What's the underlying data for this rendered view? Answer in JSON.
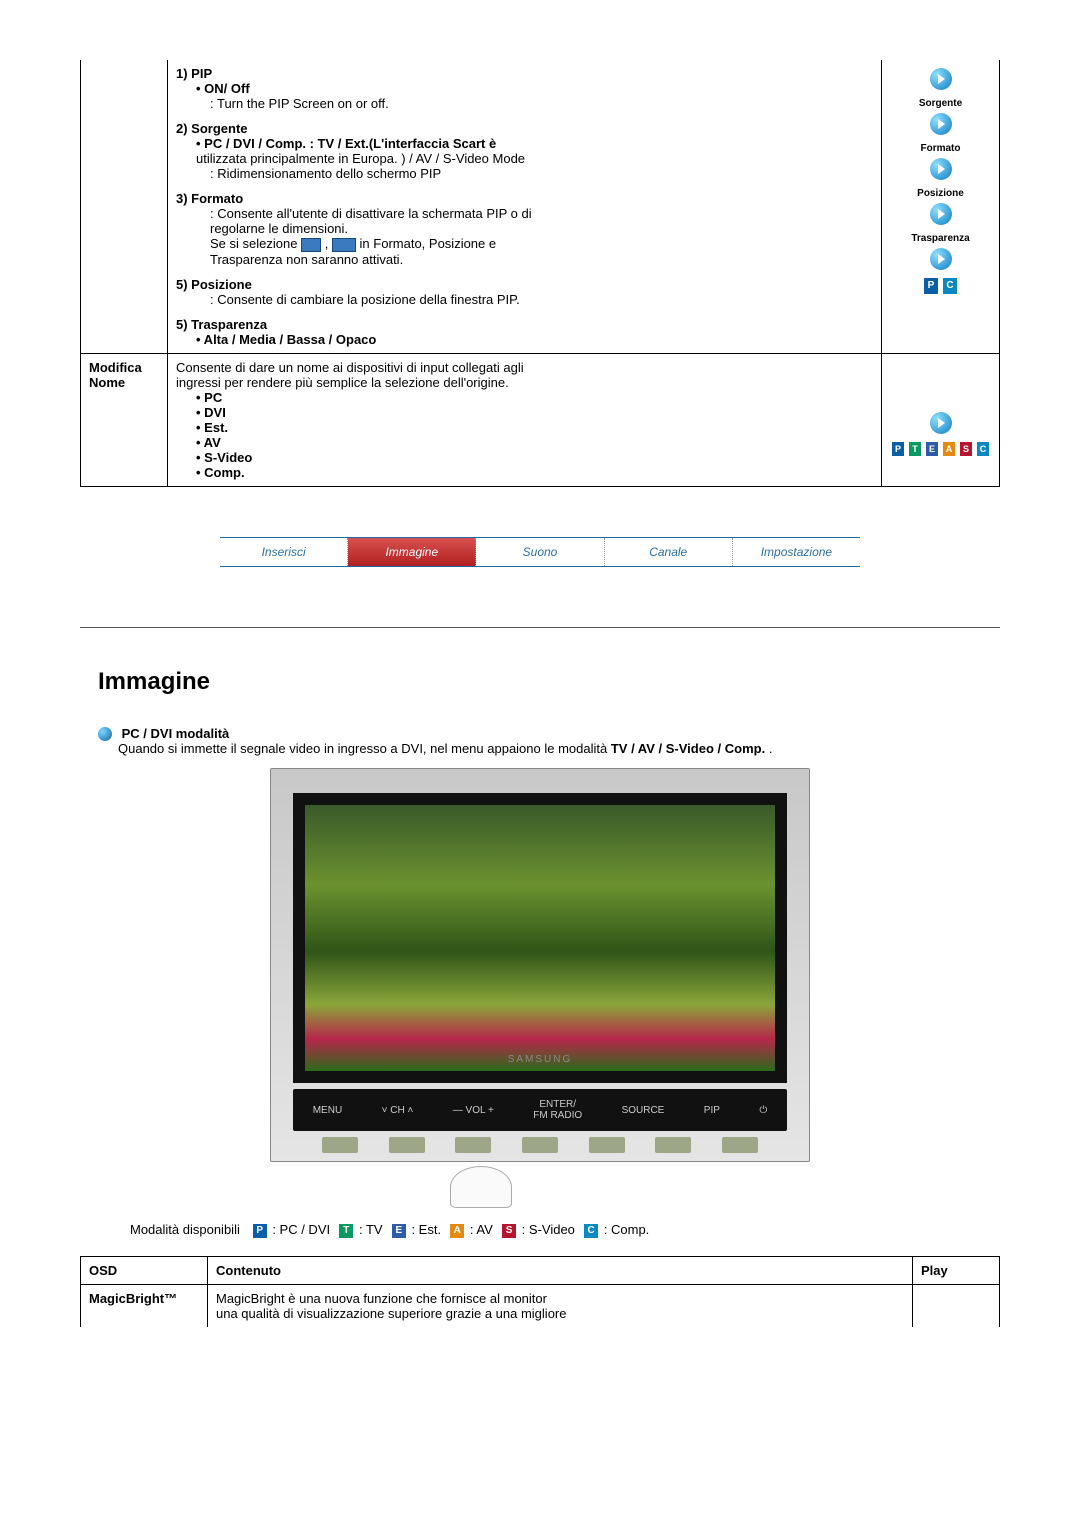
{
  "table1": {
    "pip": {
      "h": "1) PIP",
      "onoff": "• ON/ Off",
      "onoff_desc": ": Turn the PIP Screen on or off."
    },
    "sorgente": {
      "h": "2) Sorgente",
      "line1": "• PC / DVI / Comp. : TV / Ext.(L'interfaccia Scart è",
      "line2": "utilizzata principalmente in Europa. ) / AV / S-Video Mode",
      "line3": ": Ridimensionamento dello schermo PIP"
    },
    "formato": {
      "h": "3) Formato",
      "l1": ": Consente all'utente di disattivare la schermata PIP o di",
      "l2": "regolarne le dimensioni.",
      "l3a": "Se si selezione ",
      "l3b": ", ",
      "l3c": " in Formato, Posizione e",
      "l4": "Trasparenza non saranno attivati."
    },
    "posizione": {
      "h": "5) Posizione",
      "l1": ": Consente di cambiare la posizione della finestra PIP."
    },
    "trasparenza": {
      "h": "5) Trasparenza",
      "l1": "• Alta / Media / Bassa / Opaco"
    },
    "side": {
      "sorgente": "Sorgente",
      "formato": "Formato",
      "posizione": "Posizione",
      "trasparenza": "Trasparenza"
    },
    "row2_left": "Modifica Nome",
    "row2": {
      "l1": "Consente di dare un nome ai dispositivi di input collegati agli",
      "l2": "ingressi per rendere più semplice la selezione dell'origine.",
      "b1": "• PC",
      "b2": "• DVI",
      "b3": "• Est.",
      "b4": "• AV",
      "b5": "• S-Video",
      "b6": "• Comp."
    }
  },
  "tabs": {
    "t1": "Inserisci",
    "t2": "Immagine",
    "t3": "Suono",
    "t4": "Canale",
    "t5": "Impostazione"
  },
  "section_title": "Immagine",
  "note": {
    "h": "PC / DVI modalità",
    "l1a": "Quando si immette il segnale video in ingresso a DVI, nel menu appaiono le modalità ",
    "l1b": "TV / AV / S-Video / Comp.",
    "l1c": "."
  },
  "tv": {
    "menu": "MENU",
    "ch": "CH",
    "vol": "VOL",
    "enter": "ENTER/\nFM RADIO",
    "source": "SOURCE",
    "pip": "PIP",
    "brand": "SAMSUNG"
  },
  "modes": {
    "lead": "Modalità disponibili",
    "p": "P",
    "p_l": ": PC / DVI",
    "t": "T",
    "t_l": ": TV",
    "e": "E",
    "e_l": ": Est.",
    "a": "A",
    "a_l": ": AV",
    "s": "S",
    "s_l": ": S-Video",
    "c": "C",
    "c_l": ": Comp."
  },
  "table2": {
    "h1": "OSD",
    "h2": "Contenuto",
    "h3": "Play",
    "r1c1": "MagicBright™",
    "r1c2a": "MagicBright è una nuova funzione che fornisce al monitor",
    "r1c2b": "una qualità di visualizzazione superiore grazie a una migliore"
  }
}
